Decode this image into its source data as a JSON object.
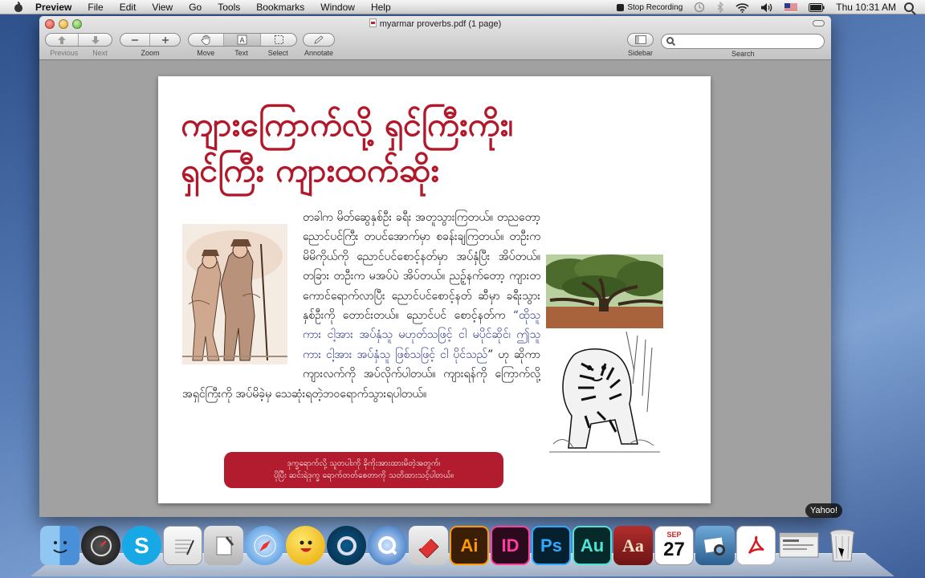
{
  "menubar": {
    "app_name": "Preview",
    "menus": [
      "File",
      "Edit",
      "View",
      "Go",
      "Tools",
      "Bookmarks",
      "Window",
      "Help"
    ],
    "stop_recording": "Stop Recording",
    "clock": "Thu 10:31 AM"
  },
  "window": {
    "title": "myarmar proverbs.pdf (1 page)",
    "toolbar": {
      "previous": "Previous",
      "next": "Next",
      "zoom": "Zoom",
      "move": "Move",
      "text": "Text",
      "select": "Select",
      "annotate": "Annotate",
      "sidebar": "Sidebar",
      "search": "Search",
      "search_placeholder": ""
    }
  },
  "document": {
    "headline_line1": "ကျားကြောက်လို့ ရှင်ကြီးကိုး၊",
    "headline_line2": "ရှင်ကြီး ကျားထက်ဆိုး",
    "body_plain": "တခါက မိတ်ဆွေနှစ်ဦး ခရီး အတူသွားကြတယ်။ တညတော့ ညောင်ပင်ကြီး တပင်အောက်မှာ စခန်းချကြတယ်။ တဦးက မိမိကိုယ်ကို ညောင်ပင်စောင့်နတ်မှာ အပ်နှံပြီး အိပ်တယ်။ တခြား တဦးက မအပ်ပဲ အိပ်တယ်။ ညဉ့်နက်တော့ ကျားတကောင်ရောက်လာပြီး ညောင်ပင်စောင့်နတ် ဆီမှာ ခရီးသွားနှစ်ဦးကို တောင်းတယ်။ ညောင်ပင် စောင့်နတ်က",
    "body_quote": "“ထိုသူကား ငါ့အား အပ်နှံသူ မဟုတ်သဖြင့် ငါ မပိုင်ဆိုင်၊ ဤသူကား ငါ့အား အပ်နှံသူ ဖြစ်သဖြင့် ငါ ပိုင်သည်",
    "body_end": "” ဟု ဆိုကာ ကျားလက်ကို အပ်လိုက်ပါတယ်။ ကျားရန်ကို ကြောက်လို့ အရှင်ကြီးကို အပ်မိခဲ့မှ သေဆုံးရတဲ့ဘဝရောက်သွားရပါတယ်။",
    "callout_line1": "ဒုက္ခရောက်လို့ သူတပါးကို ခိုကိုးအားထားမိတဲ့အတွက်၊",
    "callout_line2": "ပိုပြီး ဆင်းရဲဒုက္ခ ရောက်တတ်စေတာကို သတိထားသင့်ပါတယ်။"
  },
  "dock": {
    "tooltip": "Yahoo!",
    "icons": [
      "finder-icon",
      "dashboard-icon",
      "skype-icon",
      "textedit-icon",
      "script-editor-icon",
      "safari-icon",
      "yahoo-messenger-icon",
      "cinema4d-icon",
      "quicktime-icon",
      "flashcard-icon",
      "illustrator-icon",
      "indesign-icon",
      "photoshop-icon",
      "audition-icon",
      "dictionary-icon",
      "ical-icon",
      "iphoto-icon",
      "acrobat-icon",
      "window-thumbnail-icon",
      "trash-icon"
    ],
    "ai_label": "Ai",
    "id_label": "ID",
    "ps_label": "Ps",
    "au_label": "Au",
    "dict_label": "Aa",
    "cal_month": "SEP",
    "cal_day": "27"
  },
  "colors": {
    "headline": "#b1192b",
    "callout_bg": "#b21c2e",
    "quote_text": "#2e3a8c",
    "window_bg": "#a1a1a1"
  }
}
